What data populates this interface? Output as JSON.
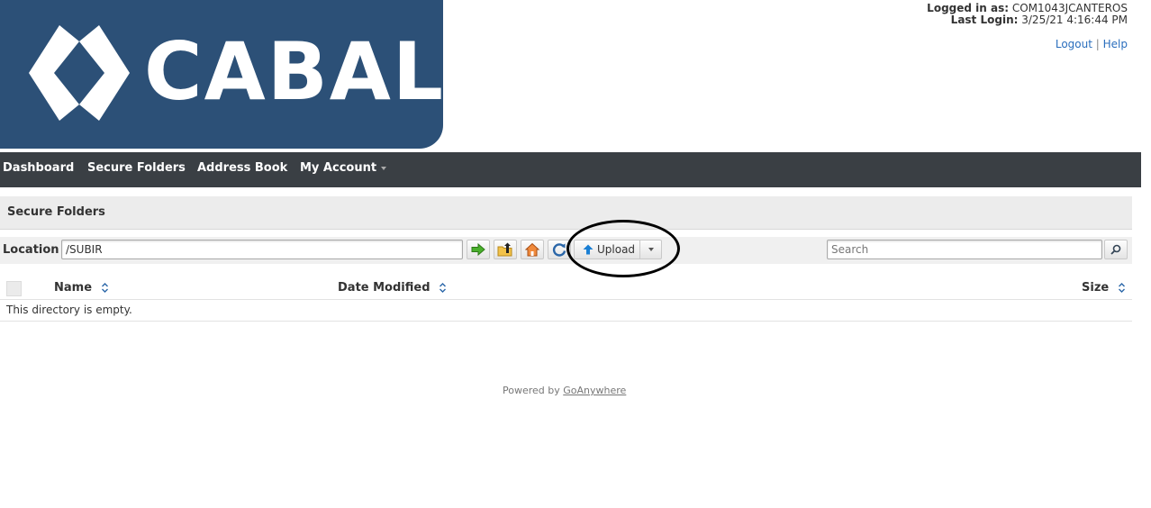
{
  "brand": {
    "name": "CABAL",
    "color": "#2c5077"
  },
  "user": {
    "logged_in_label": "Logged in as:",
    "username": "COM1043JCANTEROS",
    "last_login_label": "Last Login:",
    "last_login": "3/25/21 4:16:44 PM"
  },
  "top_links": {
    "logout": "Logout",
    "separator": "|",
    "help": "Help"
  },
  "nav": {
    "dashboard": "Dashboard",
    "secure_folders": "Secure Folders",
    "address_book": "Address Book",
    "my_account": "My Account"
  },
  "section": {
    "title": "Secure Folders"
  },
  "toolbar": {
    "location_label": "Location",
    "location_value": "/SUBIR",
    "go_icon": "arrow-right-icon",
    "up_icon": "folder-up-icon",
    "home_icon": "home-icon",
    "refresh_icon": "refresh-icon",
    "upload_label": "Upload",
    "search_placeholder": "Search"
  },
  "table": {
    "columns": {
      "name": "Name",
      "date_modified": "Date Modified",
      "size": "Size"
    },
    "empty_message": "This directory is empty."
  },
  "footer": {
    "powered_by": "Powered by",
    "vendor": "GoAnywhere"
  }
}
